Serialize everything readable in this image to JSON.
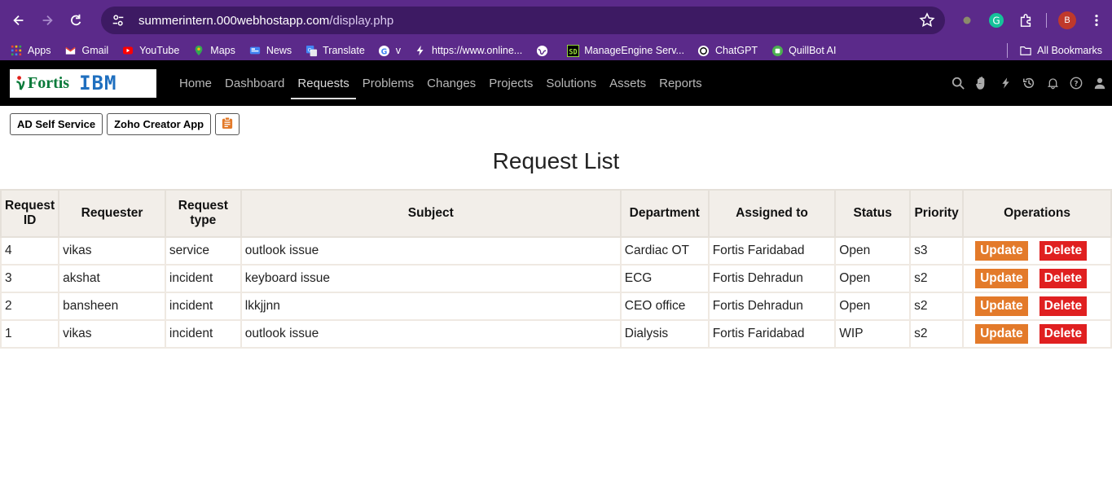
{
  "browser": {
    "url_host": "summerintern.000webhostapp.com",
    "url_path": "/display.php",
    "profile_initial": "B"
  },
  "bookmarks": [
    {
      "label": "Apps",
      "icon": "apps-grid-icon"
    },
    {
      "label": "Gmail",
      "icon": "gmail-icon"
    },
    {
      "label": "YouTube",
      "icon": "youtube-icon"
    },
    {
      "label": "Maps",
      "icon": "maps-icon"
    },
    {
      "label": "News",
      "icon": "news-icon"
    },
    {
      "label": "Translate",
      "icon": "translate-icon"
    },
    {
      "label": "v",
      "icon": "google-icon"
    },
    {
      "label": "https://www.online...",
      "icon": "bolt-icon"
    },
    {
      "label": "",
      "icon": "globe-icon"
    },
    {
      "label": "ManageEngine Serv...",
      "icon": "manageengine-icon"
    },
    {
      "label": "ChatGPT",
      "icon": "chatgpt-icon"
    },
    {
      "label": "QuillBot AI",
      "icon": "quillbot-icon"
    }
  ],
  "all_bookmarks": "All Bookmarks",
  "nav": {
    "logo_text_1": "Fortis",
    "logo_text_2": "IBM",
    "links": [
      "Home",
      "Dashboard",
      "Requests",
      "Problems",
      "Changes",
      "Projects",
      "Solutions",
      "Assets",
      "Reports"
    ],
    "active": "Requests"
  },
  "toolbar": {
    "ad_self_service": "AD Self Service",
    "zoho_creator": "Zoho Creator App"
  },
  "page_title": "Request List",
  "table": {
    "headers": [
      "Request ID",
      "Requester",
      "Request type",
      "Subject",
      "Department",
      "Assigned to",
      "Status",
      "Priority",
      "Operations"
    ],
    "rows": [
      {
        "id": "4",
        "requester": "vikas",
        "type": "service",
        "subject": "outlook issue",
        "department": "Cardiac OT",
        "assigned": "Fortis Faridabad",
        "status": "Open",
        "priority": "s3"
      },
      {
        "id": "3",
        "requester": "akshat",
        "type": "incident",
        "subject": "keyboard issue",
        "department": "ECG",
        "assigned": "Fortis Dehradun",
        "status": "Open",
        "priority": "s2"
      },
      {
        "id": "2",
        "requester": "bansheen",
        "type": "incident",
        "subject": "lkkjjnn",
        "department": "CEO office",
        "assigned": "Fortis Dehradun",
        "status": "Open",
        "priority": "s2"
      },
      {
        "id": "1",
        "requester": "vikas",
        "type": "incident",
        "subject": "outlook issue",
        "department": "Dialysis",
        "assigned": "Fortis Faridabad",
        "status": "WIP",
        "priority": "s2"
      }
    ],
    "update_label": "Update",
    "delete_label": "Delete"
  },
  "colors": {
    "chrome": "#5b2a8a",
    "update": "#e37a2a",
    "delete": "#e02020"
  }
}
